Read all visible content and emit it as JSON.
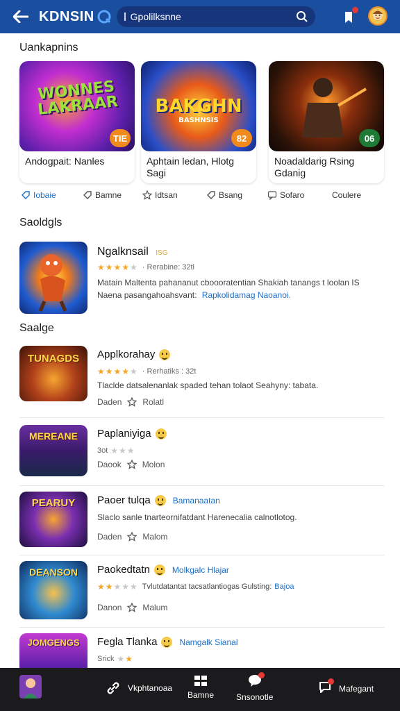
{
  "header": {
    "brand": "KDNSIN",
    "search_value": "Gpolilksnne",
    "colors": {
      "bar": "#1a4fa0",
      "search_bg": "#16357a"
    }
  },
  "section_top": {
    "title": "Uankapnins",
    "cards": [
      {
        "art_text": "WONNES LAKRAAR",
        "badge": "TIE",
        "badge_color": "#f08a1c",
        "label": "Andogpait: Nanles"
      },
      {
        "art_text": "BAKGHN",
        "art_sub": "BASHNSIS",
        "badge": "82",
        "badge_color": "#f08a1c",
        "label": "Aphtain ledan, Hlotg Sagi"
      },
      {
        "art_text": "",
        "badge": "06",
        "badge_color": "#1f7a36",
        "label": "Noadaldarig Rsing Gdanig"
      }
    ],
    "chips": [
      "Iobaie",
      "Bamne",
      "Idtsan",
      "Bsang",
      "Sofaro",
      "Coulere"
    ]
  },
  "section_featured": {
    "title": "Saoldgls",
    "item": {
      "title": "Ngalknsail",
      "title_tag": "ISG",
      "stars": 4,
      "rating_text": "· Rerabine: 32tl",
      "desc_line1": "Matain Maltenta pahananut cboooratentian Shakiah tanangs t loolan IS",
      "desc_line2": "Naena pasangahoahsvant:",
      "desc_link": "Rapkolidamag Naoanoi."
    }
  },
  "section_list": {
    "title": "Saalge",
    "items": [
      {
        "art_text": "TUNAGDS",
        "title": "Applkorahay",
        "link": "",
        "stars": 4,
        "rating_text": "· Rerhatiks : 32t",
        "desc": "Tlaclde datsalenanlak spaded tehan tolaot Seahyny: tabata.",
        "meta": "Daden",
        "meta2": "Rolatl"
      },
      {
        "art_text": "MEREANE",
        "title": "Paplaniyiga",
        "link": "",
        "stars": 0,
        "rating_text": "3ot",
        "desc": "",
        "meta": "Daook",
        "meta2": "Molon"
      },
      {
        "art_text": "PEARUY",
        "title": "Paoer tulqa",
        "link": "Bamanaatan",
        "stars": 0,
        "rating_text": "",
        "desc": "Slaclo sanle tnarteornifatdant Harenecalia calnotlotog.",
        "meta": "Daden",
        "meta2": "Malom"
      },
      {
        "art_text": "DEANSON",
        "title": "Paokedtatn",
        "link": "Molkgalc Hlajar",
        "stars": 2,
        "rating_text": "",
        "desc": "Tvlutdatantat tacsatlantiogas Gulsting:",
        "desc_link": "Bajoa",
        "meta": "Danon",
        "meta2": "Malum"
      },
      {
        "art_text": "JOMGENGS",
        "title": "Fegla Tlanka",
        "link": "Namgalk Sianal",
        "stars": 2,
        "rating_text": "Srick",
        "desc": "",
        "meta": "",
        "meta2": ""
      }
    ]
  },
  "bottom_bar": {
    "items": [
      {
        "label": "Vkphtanoaa"
      },
      {
        "label": "Bamne"
      },
      {
        "label": "Snsonotle"
      },
      {
        "label": "Mafegant"
      }
    ]
  }
}
